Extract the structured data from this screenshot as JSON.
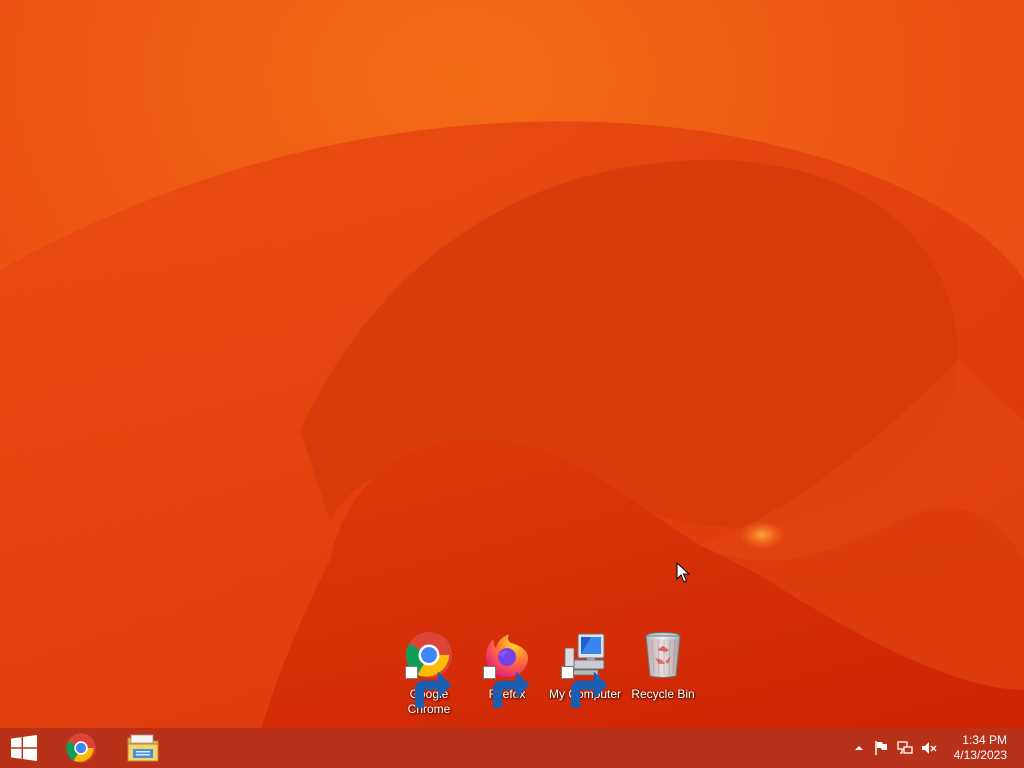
{
  "desktop": {
    "icons": [
      {
        "label": "Google\nChrome",
        "icon": "chrome-icon",
        "shortcut": true
      },
      {
        "label": "Firefox",
        "icon": "firefox-icon",
        "shortcut": true
      },
      {
        "label": "My Computer",
        "icon": "my-computer-icon",
        "shortcut": true
      },
      {
        "label": "Recycle Bin",
        "icon": "recycle-bin-icon",
        "shortcut": false
      }
    ]
  },
  "taskbar": {
    "pinned": [
      "start-icon",
      "chrome-icon",
      "file-explorer-icon"
    ],
    "tray": [
      "show-hidden-icons-chevron",
      "action-center-flag-icon",
      "network-icon",
      "volume-muted-icon"
    ],
    "clock": {
      "time": "1:34 PM",
      "date": "4/13/2023"
    }
  },
  "colors": {
    "wallpaper_base": "#e84a10",
    "wallpaper_dark": "#cc2a08",
    "wallpaper_light": "#f26a18",
    "taskbar": "#b8321a"
  }
}
